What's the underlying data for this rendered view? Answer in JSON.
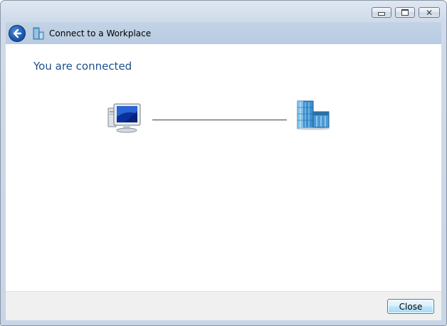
{
  "window": {
    "title": "Connect to a Workplace",
    "caption_buttons": [
      "minimize",
      "maximize",
      "close"
    ]
  },
  "header": {
    "back_icon": "back-arrow-icon",
    "title_icon": "workplace-building-icon",
    "title": "Connect to a Workplace"
  },
  "main": {
    "heading": "You are connected",
    "diagram": {
      "left_icon": "computer-icon",
      "right_icon": "workplace-network-icon",
      "status": "connected"
    }
  },
  "footer": {
    "close_label": "Close"
  },
  "colors": {
    "heading": "#1e4f8a",
    "header_bar": "#b8cbe2",
    "footer_bg": "#f0f0f0",
    "button_border": "#3c7fb1"
  }
}
